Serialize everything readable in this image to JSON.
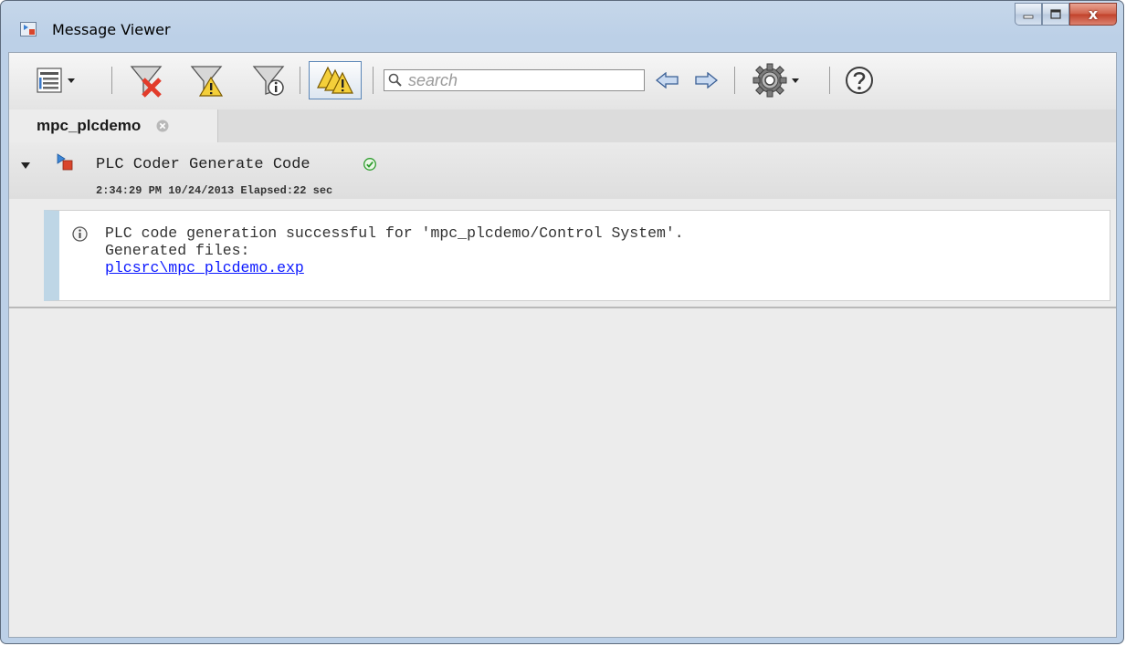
{
  "window": {
    "title": "Message Viewer",
    "close_glyph": "x"
  },
  "toolbar": {
    "icons": [
      "message-list-icon",
      "dropdown-arrow-icon",
      "filter-errors-icon",
      "filter-warnings-icon",
      "filter-info-icon",
      "toggle-warnings-icon",
      "search-icon",
      "back-arrow-icon",
      "forward-arrow-icon",
      "gear-icon",
      "help-icon"
    ],
    "search_placeholder": "search"
  },
  "tab": {
    "label": "mpc_plcdemo"
  },
  "group": {
    "title": "PLC Coder Generate Code",
    "meta": "2:34:29 PM 10/24/2013 Elapsed:22 sec"
  },
  "message": {
    "line1": "PLC code generation successful for 'mpc_plcdemo/Control System'.",
    "line2": "Generated files:",
    "link": "plcsrc\\mpc_plcdemo.exp"
  },
  "colors": {
    "titlebar": "#bcd0e7",
    "message_accent": "#bed6e6",
    "link": "#0b18ff",
    "close_button": "#c1412a",
    "success": "#2e9d2e"
  }
}
